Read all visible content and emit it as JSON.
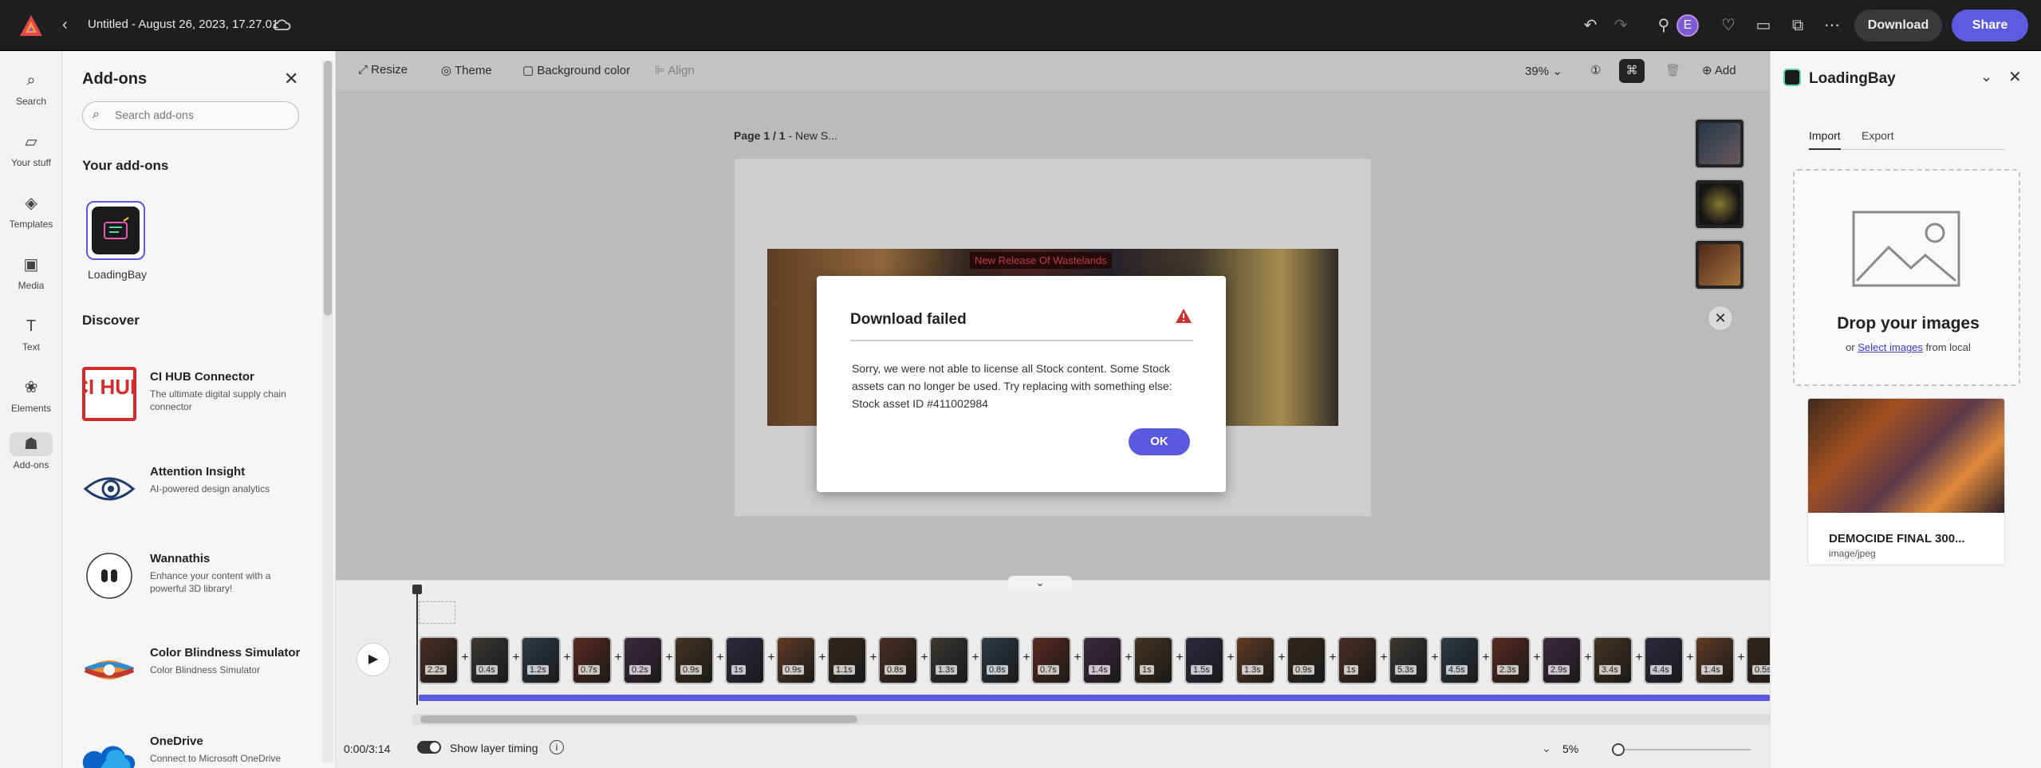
{
  "app": {
    "doc_title": "Untitled - August 26, 2023, 17.27.01",
    "avatar_initial": "E",
    "download_label": "Download",
    "share_label": "Share"
  },
  "rail": [
    {
      "label": "Search",
      "icon": "search-icon"
    },
    {
      "label": "Your stuff",
      "icon": "folder-icon"
    },
    {
      "label": "Templates",
      "icon": "templates-icon"
    },
    {
      "label": "Media",
      "icon": "media-icon"
    },
    {
      "label": "Text",
      "icon": "text-icon"
    },
    {
      "label": "Elements",
      "icon": "elements-icon"
    },
    {
      "label": "Add-ons",
      "icon": "addons-icon"
    }
  ],
  "addons_panel": {
    "title": "Add-ons",
    "search_placeholder": "Search add-ons",
    "your_addons_heading": "Your add-ons",
    "installed": [
      {
        "name": "LoadingBay"
      }
    ],
    "discover_heading": "Discover",
    "discover": [
      {
        "title": "CI HUB Connector",
        "desc": "The ultimate digital supply chain connector",
        "icon": "ci-hub-icon",
        "badge_text": "CI HUB"
      },
      {
        "title": "Attention Insight",
        "desc": "AI-powered design analytics",
        "icon": "eye-icon"
      },
      {
        "title": "Wannathis",
        "desc": "Enhance your content with a powerful 3D library!",
        "icon": "wannathis-icon"
      },
      {
        "title": "Color Blindness Simulator",
        "desc": "Color Blindness Simulator",
        "icon": "color-wheel-icon"
      },
      {
        "title": "OneDrive",
        "desc": "Connect to Microsoft OneDrive",
        "icon": "cloud-icon"
      }
    ]
  },
  "toolbar": {
    "resize": "Resize",
    "theme": "Theme",
    "background_color": "Background color",
    "align": "Align",
    "zoom": "39%",
    "add": "Add"
  },
  "canvas": {
    "page_label_bold": "Page 1 / 1",
    "page_label_rest": " - New S...",
    "banner_text": "New Release Of Wastelands"
  },
  "dialog": {
    "title": "Download failed",
    "message": "Sorry, we were not able to license all Stock content. Some Stock assets can no longer be used. Try replacing with something else: Stock asset ID #411002984",
    "ok_label": "OK",
    "warning_icon": "warning-triangle-icon"
  },
  "timeline": {
    "current_time": "0:00/3:14",
    "show_layer_timing": "Show layer timing",
    "zoom": "5%",
    "clips": [
      "2.2s",
      "0.4s",
      "1.2s",
      "0.7s",
      "0.2s",
      "0.9s",
      "1s",
      "0.9s",
      "1.1s",
      "0.8s",
      "1.3s",
      "0.8s",
      "0.7s",
      "1.4s",
      "1s",
      "1.5s",
      "1.3s",
      "0.9s",
      "1s",
      "5.3s",
      "4.5s",
      "2.3s",
      "2.9s",
      "3.4s",
      "4.4s",
      "1.4s",
      "0.5s"
    ]
  },
  "loadingbay": {
    "title": "LoadingBay",
    "tabs": [
      "Import",
      "Export"
    ],
    "drop_heading": "Drop your images",
    "drop_or": "or",
    "select_link": "Select images",
    "from_local": "from local",
    "asset_name": "DEMOCIDE FINAL 300...",
    "asset_type": "image/jpeg"
  },
  "colors": {
    "accent": "#5a5ae0",
    "topbar": "#1e1e1e",
    "warning": "#d32f2f"
  }
}
